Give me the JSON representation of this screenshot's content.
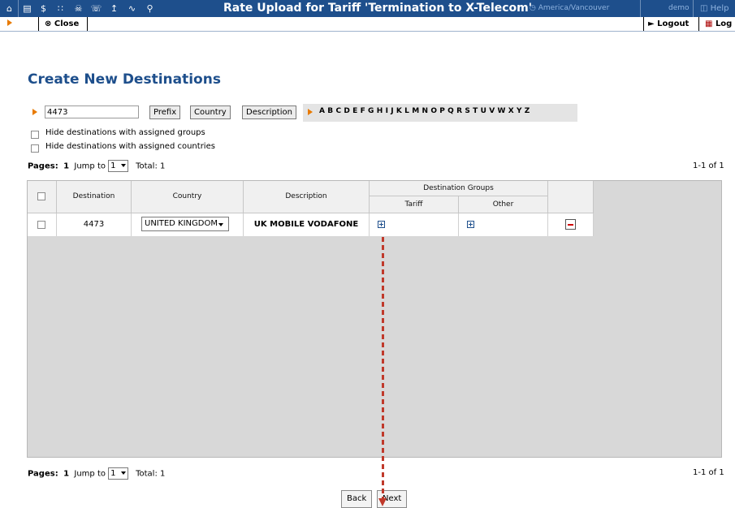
{
  "topbar": {
    "title": "Rate Upload for Tariff 'Termination to X-Telecom'",
    "timezone": "America/Vancouver",
    "user": "demo",
    "help": "Help",
    "colors": {
      "bar": "#1e4f8c",
      "dim_text": "#8fb3df"
    },
    "icons": [
      "home-icon",
      "list-icon",
      "dollar-icon",
      "grid-icon",
      "person-icon",
      "phone-icon",
      "upload-icon",
      "chart-icon",
      "search-icon"
    ]
  },
  "toolbar": {
    "close_label": "Close",
    "logout_label": "Logout",
    "log_label": "Log"
  },
  "page": {
    "title": "Create New Destinations"
  },
  "filter": {
    "search_value": "4473",
    "prefix_label": "Prefix",
    "country_label": "Country",
    "description_label": "Description",
    "letters": [
      "A",
      "B",
      "C",
      "D",
      "E",
      "F",
      "G",
      "H",
      "I",
      "J",
      "K",
      "L",
      "M",
      "N",
      "O",
      "P",
      "Q",
      "R",
      "S",
      "T",
      "U",
      "V",
      "W",
      "X",
      "Y",
      "Z"
    ]
  },
  "options": {
    "hide_groups": "Hide destinations with assigned groups",
    "hide_countries": "Hide destinations with assigned countries"
  },
  "pager": {
    "pages_label": "Pages:",
    "page": "1",
    "jump_label": "Jump to",
    "jump_value": "1",
    "total_label": "Total: 1",
    "range": "1-1 of 1"
  },
  "table": {
    "headers": {
      "destination": "Destination",
      "country": "Country",
      "description": "Description",
      "groups": "Destination Groups",
      "tariff": "Tariff",
      "other": "Other"
    },
    "rows": [
      {
        "destination": "4473",
        "country": "UNITED KINGDOM",
        "description": "UK MOBILE VODAFONE"
      }
    ]
  },
  "buttons": {
    "back": "Back",
    "next": "Next"
  },
  "accent": {
    "orange": "#e87a00",
    "annotation": "#c0392b"
  }
}
